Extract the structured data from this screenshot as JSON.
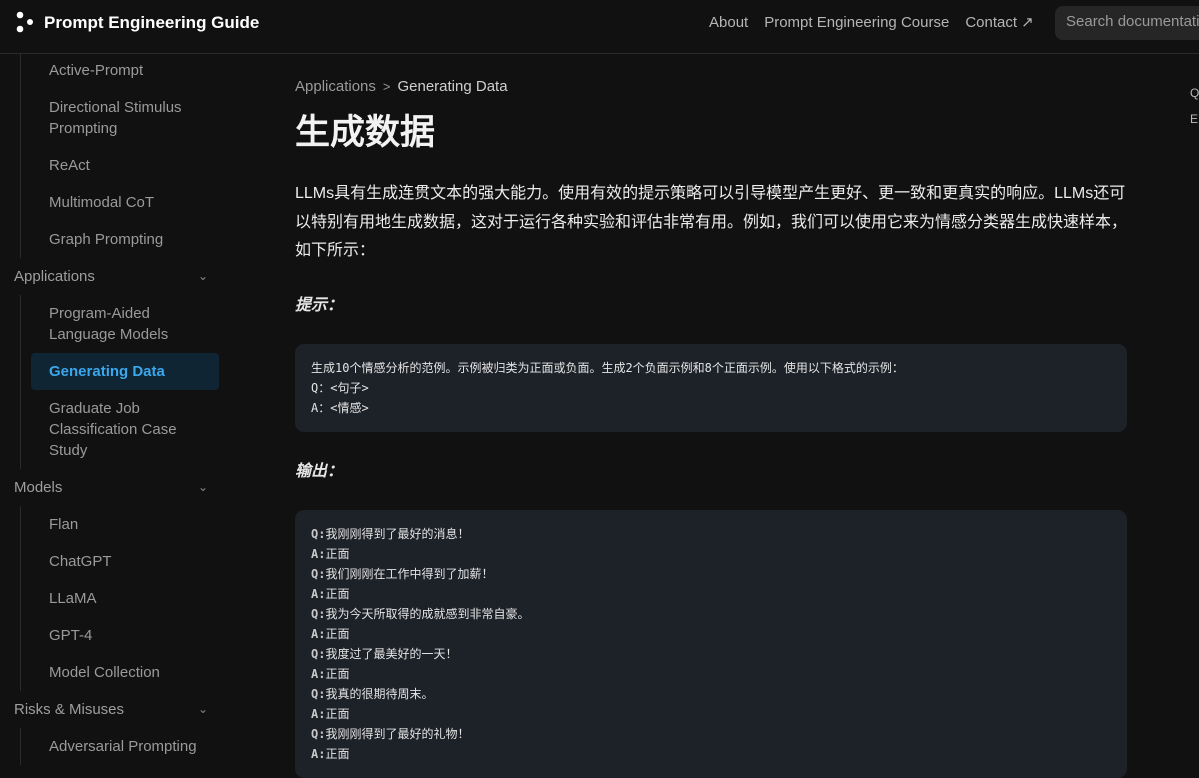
{
  "header": {
    "title": "Prompt Engineering Guide",
    "nav": [
      "About",
      "Prompt Engineering Course",
      "Contact ↗"
    ],
    "search_placeholder": "Search documentation"
  },
  "sidebar": {
    "techniques_items": [
      {
        "label": "Active-Prompt"
      },
      {
        "label": "Directional Stimulus Prompting"
      },
      {
        "label": "ReAct"
      },
      {
        "label": "Multimodal CoT"
      },
      {
        "label": "Graph Prompting"
      }
    ],
    "groups": [
      {
        "label": "Applications",
        "items": [
          "Program-Aided Language Models",
          "Generating Data",
          "Graduate Job Classification Case Study"
        ]
      },
      {
        "label": "Models",
        "items": [
          "Flan",
          "ChatGPT",
          "LLaMA",
          "GPT-4",
          "Model Collection"
        ]
      },
      {
        "label": "Risks & Misuses",
        "items": [
          "Adversarial Prompting"
        ]
      }
    ],
    "active": "Generating Data",
    "accent": "#3ba7ec"
  },
  "breadcrumb": {
    "parent": "Applications",
    "current": "Generating Data"
  },
  "page": {
    "title": "生成数据",
    "intro": "LLMs具有生成连贯文本的强大能力。使用有效的提示策略可以引导模型产生更好、更一致和更真实的响应。LLMs还可以特别有用地生成数据，这对于运行各种实验和评估非常有用。例如，我们可以使用它来为情感分类器生成快速样本，如下所示：",
    "prompt_label": "提示：",
    "prompt_lines": [
      "生成10个情感分析的范例。示例被归类为正面或负面。生成2个负面示例和8个正面示例。使用以下格式的示例：",
      "Q：<句子>",
      "A：<情感>"
    ],
    "output_label": "输出：",
    "output_lines": [
      {
        "k": "Q:",
        "v": "我刚刚得到了最好的消息！"
      },
      {
        "k": "A:",
        "v": "正面"
      },
      {
        "k": "Q:",
        "v": "我们刚刚在工作中得到了加薪！"
      },
      {
        "k": "A:",
        "v": "正面"
      },
      {
        "k": "Q:",
        "v": "我为今天所取得的成就感到非常自豪。"
      },
      {
        "k": "A:",
        "v": "正面"
      },
      {
        "k": "Q:",
        "v": "我度过了最美好的一天！"
      },
      {
        "k": "A:",
        "v": "正面"
      },
      {
        "k": "Q:",
        "v": "我真的很期待周末。"
      },
      {
        "k": "A:",
        "v": "正面"
      },
      {
        "k": "Q:",
        "v": "我刚刚得到了最好的礼物！"
      },
      {
        "k": "A:",
        "v": "正面"
      }
    ]
  },
  "toc": [
    "Q",
    "E"
  ]
}
